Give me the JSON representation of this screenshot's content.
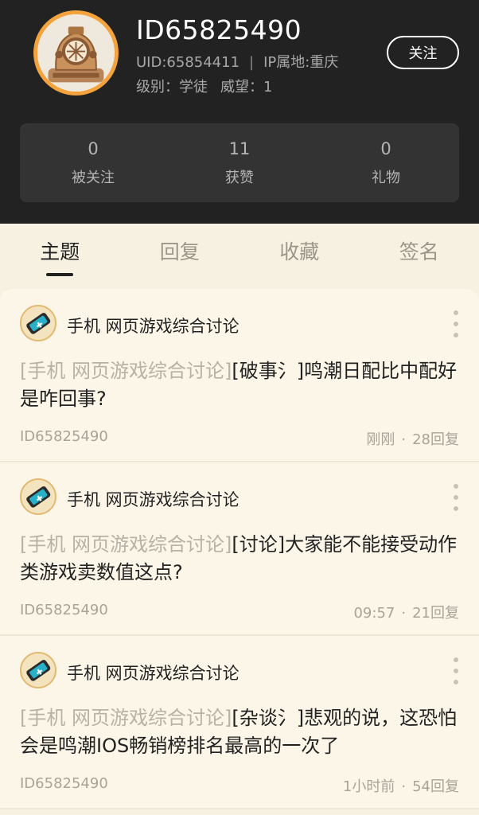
{
  "profile": {
    "username": "ID65825490",
    "uid_text": "UID:65854411",
    "ip_text": "IP属地:重庆",
    "separator": "|",
    "level_text": "级别：学徒",
    "reputation_text": "威望：1",
    "follow_label": "关注",
    "avatar_ring_color": "#f4a23c"
  },
  "stats": [
    {
      "value": "0",
      "label": "被关注"
    },
    {
      "value": "11",
      "label": "获赞"
    },
    {
      "value": "0",
      "label": "礼物"
    }
  ],
  "tabs": [
    {
      "label": "主题",
      "active": true
    },
    {
      "label": "回复",
      "active": false
    },
    {
      "label": "收藏",
      "active": false
    },
    {
      "label": "签名",
      "active": false
    }
  ],
  "posts": [
    {
      "forum": "手机 网页游戏综合讨论",
      "tag": "[手机 网页游戏综合讨论]",
      "title": "[破事氵]鸣潮日配比中配好是咋回事?",
      "author": "ID65825490",
      "time": "刚刚",
      "dot": "·",
      "replies": "28回复"
    },
    {
      "forum": "手机 网页游戏综合讨论",
      "tag": "[手机 网页游戏综合讨论]",
      "title": "[讨论]大家能不能接受动作类游戏卖数值这点?",
      "author": "ID65825490",
      "time": "09:57",
      "dot": "·",
      "replies": "21回复"
    },
    {
      "forum": "手机 网页游戏综合讨论",
      "tag": "[手机 网页游戏综合讨论]",
      "title": "[杂谈氵]悲观的说，这恐怕会是鸣潮IOS畅销榜排名最高的一次了",
      "author": "ID65825490",
      "time": "1小时前",
      "dot": "·",
      "replies": "54回复"
    }
  ],
  "icons": {
    "avatar": "diving-helmet-icon",
    "forum": "game-phone-icon",
    "more": "more-vertical-icon"
  }
}
